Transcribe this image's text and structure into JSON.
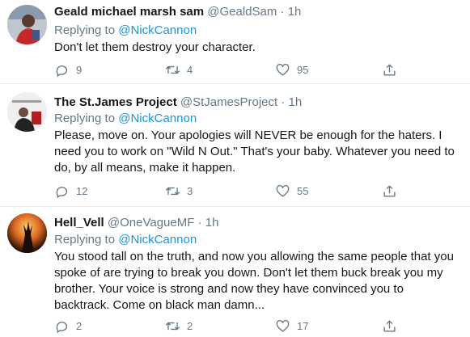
{
  "tweets": [
    {
      "display_name": "Geald michael marsh sam",
      "handle": "@GealdSam",
      "time": "1h",
      "replying_prefix": "Replying to",
      "replying_to": "@NickCannon",
      "text": "Don't let them destroy your character.",
      "replies": "9",
      "retweets": "4",
      "likes": "95"
    },
    {
      "display_name": "The St.James Project",
      "handle": "@StJamesProject",
      "time": "1h",
      "replying_prefix": "Replying to",
      "replying_to": "@NickCannon",
      "text": "Please, move on. Your apologies will NEVER be enough for the haters. I need you to work on \"Wild N Out.\"  That's your baby. Whatever you need to do, by all means, make it happen.",
      "replies": "12",
      "retweets": "3",
      "likes": "55"
    },
    {
      "display_name": "Hell_Vell",
      "handle": "@OneVagueMF",
      "time": "1h",
      "replying_prefix": "Replying to",
      "replying_to": "@NickCannon",
      "text": "You stood tall on the truth, and now you allowing the same people that you spoke of are trying to break you down. Don't let them buck break you my brother. Your voice is strong and now they have convinced you to backtrack. Come on black man damn...",
      "replies": "2",
      "retweets": "2",
      "likes": "17"
    }
  ],
  "icons": [
    "reply-icon",
    "retweet-icon",
    "like-icon",
    "share-icon"
  ],
  "colors": {
    "link": "#1b95e0",
    "muted": "#657786",
    "divider": "#e6ecf0"
  }
}
